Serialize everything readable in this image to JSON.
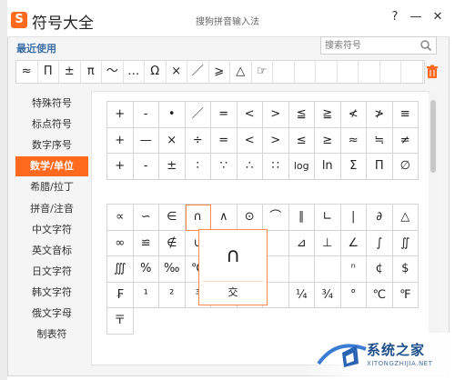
{
  "app": {
    "logo_glyph": "S",
    "title": "符号大全",
    "window_caption": "搜狗拼音输入法",
    "buttons": {
      "help": "?",
      "minimize": "—",
      "close": "✕"
    }
  },
  "recent": {
    "label": "最近使用",
    "symbols": [
      "≈",
      "Π",
      "±",
      "π",
      "～",
      "…",
      "Ω",
      "×",
      "／",
      "⩾",
      "△",
      "☞",
      "",
      "",
      "",
      "",
      "",
      "",
      ""
    ]
  },
  "search": {
    "placeholder": "搜索符号"
  },
  "sidebar": {
    "items": [
      {
        "label": "特殊符号"
      },
      {
        "label": "标点符号"
      },
      {
        "label": "数字序号"
      },
      {
        "label": "数学/单位",
        "active": true
      },
      {
        "label": "希腊/拉丁"
      },
      {
        "label": "拼音/注音"
      },
      {
        "label": "中文字符"
      },
      {
        "label": "英文音标"
      },
      {
        "label": "日文字符"
      },
      {
        "label": "韩文字符"
      },
      {
        "label": "俄文字母"
      },
      {
        "label": "制表符"
      }
    ]
  },
  "grid1": {
    "cells": [
      "+",
      "-",
      "•",
      "／",
      "=",
      "<",
      ">",
      "≦",
      "≧",
      "≮",
      "≯",
      "≡",
      "+",
      "—",
      "×",
      "÷",
      "=",
      "<",
      ">",
      "≤",
      "≥",
      "≈",
      "≒",
      "≠",
      "+",
      "-",
      "±",
      "∶",
      "∵",
      "∴",
      "∷",
      "log",
      "ln",
      "Σ",
      "Π",
      "∅"
    ]
  },
  "grid2": {
    "cells": [
      "∝",
      "∽",
      "∈",
      "∩",
      "∧",
      "⊙",
      "⌒",
      "∥",
      "∟",
      "|",
      "∂",
      "△",
      "∞",
      "≌",
      "∉",
      "∪",
      "∨",
      "",
      "",
      "⊿",
      "⊥",
      "∠",
      "∫",
      "∬",
      "∭",
      "%",
      "‰",
      "℃",
      "⊆",
      "",
      "",
      "",
      "",
      "ⁿ",
      "¢",
      "$",
      "₣",
      "¹",
      "²",
      "³",
      "½",
      "",
      "",
      "¼",
      "¾",
      "°",
      "℃",
      "℉",
      "〒"
    ],
    "selected_index": 3
  },
  "preview": {
    "symbol": "∩",
    "name": "交"
  },
  "watermark": {
    "brand": "系统之家",
    "url": "XITONGZHIJIA.NET"
  },
  "colors": {
    "accent": "#ff6a1f",
    "brand_blue": "#1d4f8c",
    "link_blue": "#3b6fa8"
  },
  "icons": {
    "search": "search-icon",
    "trash": "trash-icon"
  }
}
